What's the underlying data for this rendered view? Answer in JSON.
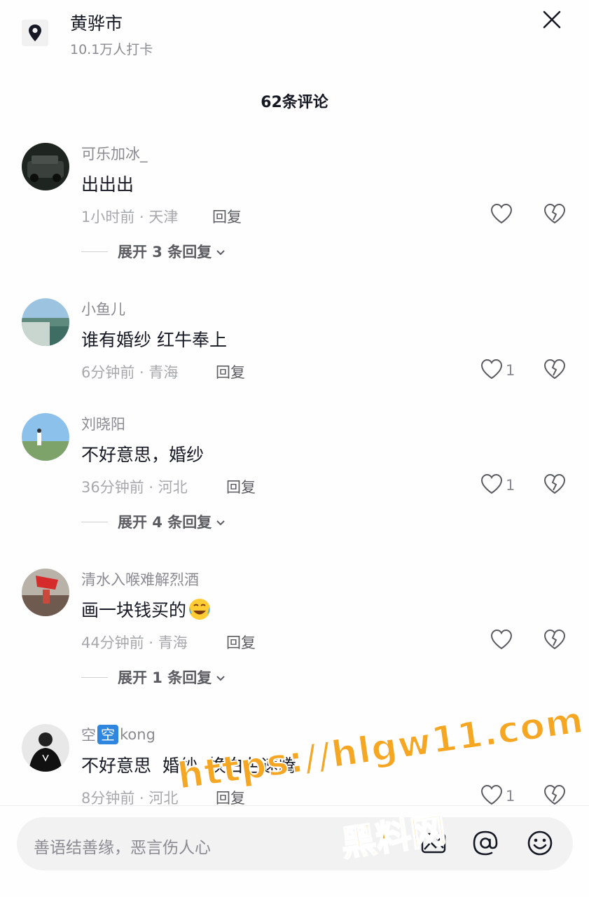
{
  "location": {
    "title": "黄骅市",
    "checkins": "10.1万人打卡"
  },
  "comment_count": "62条评论",
  "reply_label": "回复",
  "comments": [
    {
      "user": "可乐加冰_",
      "text": "出出出",
      "meta": "1小时前 · 天津",
      "likes": "",
      "expand": "展开 3 条回复"
    },
    {
      "user": "小鱼儿",
      "text": "谁有婚纱 红牛奉上",
      "meta": "6分钟前 · 青海",
      "likes": "1",
      "expand": ""
    },
    {
      "user": "刘晓阳",
      "text": "不好意思，婚纱",
      "meta": "36分钟前 · 河北",
      "likes": "1",
      "expand": "展开 4 条回复"
    },
    {
      "user": "清水入喉难解烈酒",
      "text": "画一块钱买的",
      "meta": "44分钟前 · 青海",
      "likes": "",
      "expand": "展开 1 条回复"
    },
    {
      "user_prefix": "空",
      "user_badge": "空",
      "user_suffix": "kong",
      "text": "不好意思  婚纱  换白色速腾",
      "meta": "8分钟前 · 河北",
      "likes": "1",
      "expand": ""
    }
  ],
  "input": {
    "placeholder": "善语结善缘，恶言伤人心"
  },
  "watermark": {
    "url": "https://hlgw11.com",
    "name": "黑料网"
  },
  "colors": {
    "accent": "#f5a623",
    "badge": "#2e86de"
  }
}
